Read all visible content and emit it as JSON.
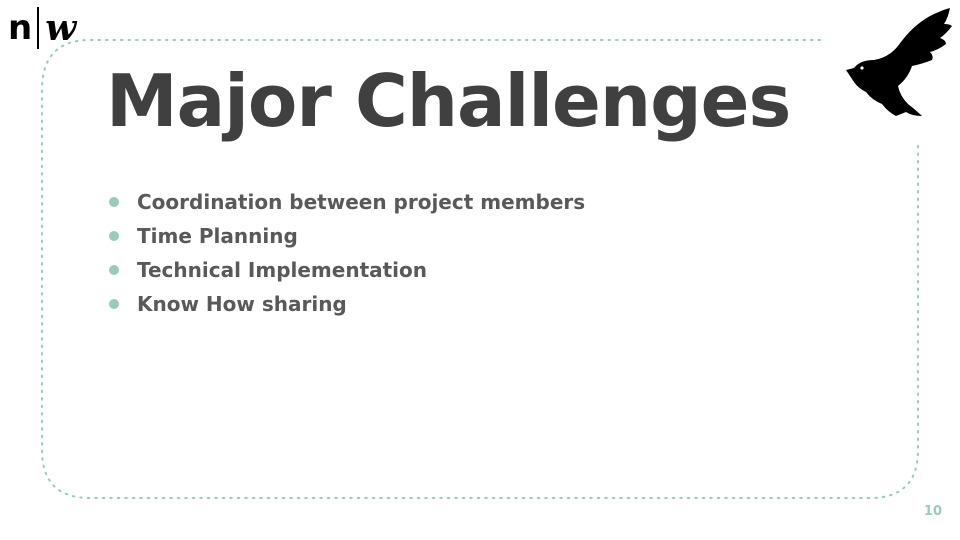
{
  "slide": {
    "logo": {
      "left": "n",
      "right": "w"
    },
    "title": "Major Challenges",
    "bullets": [
      "Coordination between project members",
      "Time Planning",
      "Technical Implementation",
      "Know How sharing"
    ],
    "page_number": "10",
    "icons": {
      "logo": "fhnw-logo",
      "bird": "bird-icon"
    },
    "colors": {
      "accent": "#99cbb6",
      "title": "#404040",
      "body_text": "#595959"
    }
  }
}
